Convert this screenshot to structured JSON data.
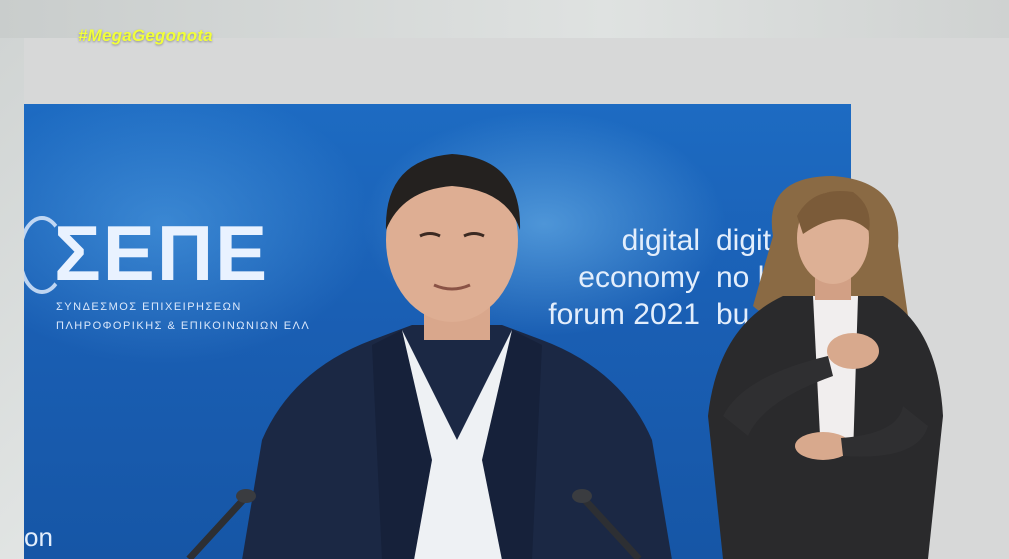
{
  "hashtag": "#MegaGegonota",
  "backdrop": {
    "logo": "ΣΕΠΕ",
    "logo_sub_1": "ΣΥΝΔΕΣΜΟΣ ΕΠΙΧΕΙΡΗΣΕΩΝ",
    "logo_sub_2": "ΠΛΗΡΟΦΟΡΙΚΗΣ & ΕΠΙΚΟΙΝΩΝΙΩΝ ΕΛΛ",
    "event_lines": [
      "digital",
      "economy",
      "forum 2021"
    ],
    "event_lines_cut": [
      "digit",
      "no l",
      "bu"
    ],
    "bottom_fragment": "on"
  }
}
